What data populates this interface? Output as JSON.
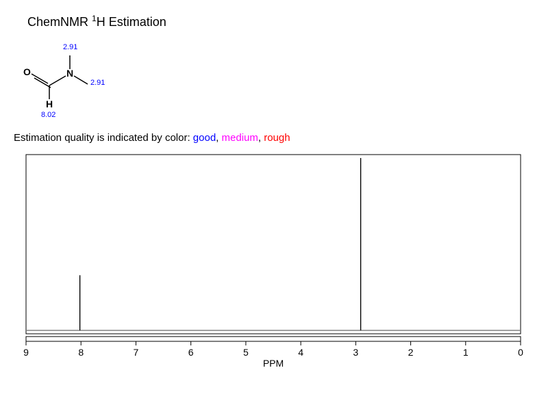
{
  "title_prefix": "ChemNMR ",
  "title_sup": "1",
  "title_rest": "H Estimation",
  "molecule": {
    "atom_O": "O",
    "atom_N": "N",
    "atom_H": "H",
    "shift_top": "2.91",
    "shift_right": "2.91",
    "shift_bottom": "8.02"
  },
  "quality": {
    "prefix": "Estimation quality is indicated by color: ",
    "good": "good",
    "sep": ", ",
    "medium": "medium",
    "rough": "rough"
  },
  "chart_data": {
    "type": "line",
    "xlabel": "PPM",
    "ylabel": "",
    "xlim": [
      9,
      0
    ],
    "ylim": [
      0,
      100
    ],
    "ticks": [
      "9",
      "8",
      "7",
      "6",
      "5",
      "4",
      "3",
      "2",
      "1",
      "0"
    ],
    "peaks": [
      {
        "ppm": 8.02,
        "intensity": 32
      },
      {
        "ppm": 2.91,
        "intensity": 100
      }
    ]
  }
}
